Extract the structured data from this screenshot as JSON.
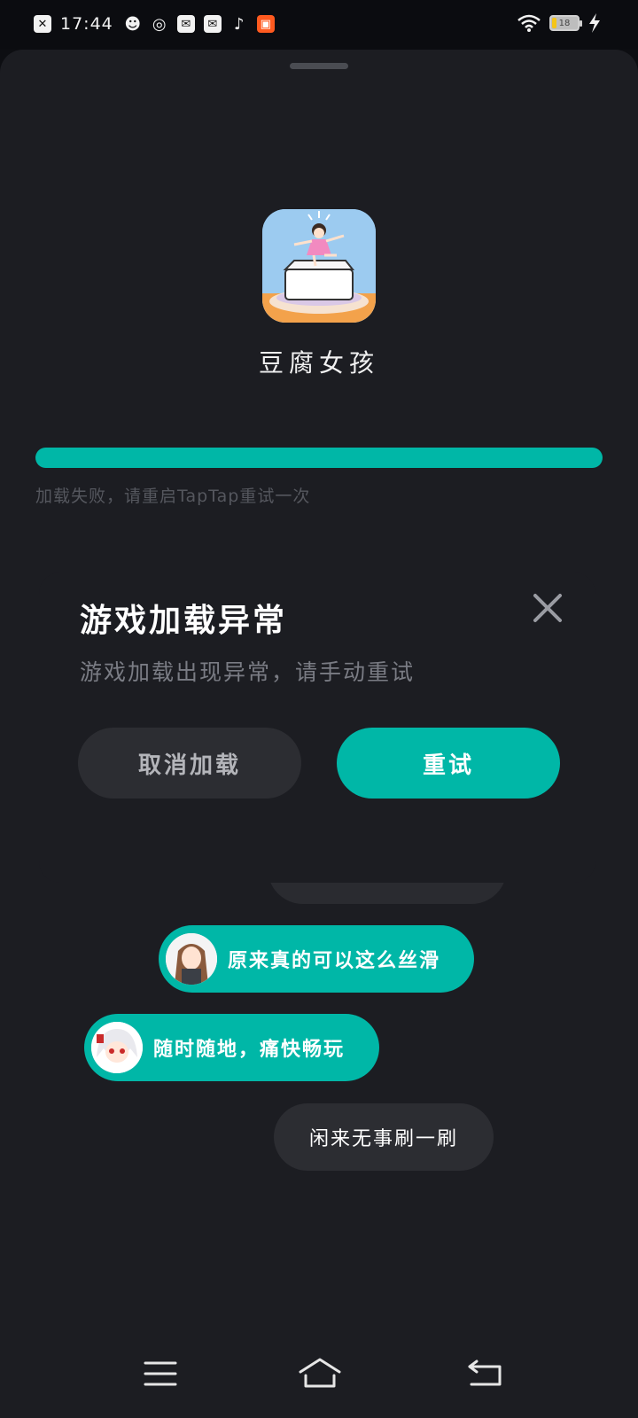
{
  "status_bar": {
    "time": "17:44",
    "battery_level": "18",
    "notification_icons": [
      "close-box-icon",
      "robot-icon",
      "planet-icon",
      "mail-icon",
      "mail-icon",
      "tiktok-icon",
      "app-orange-icon"
    ],
    "right_icons": [
      "wifi-icon",
      "battery-icon",
      "charging-icon"
    ]
  },
  "app": {
    "name": "豆腐女孩",
    "progress_percent": 100
  },
  "load_error_text": "加载失败，请重启TapTap重试一次",
  "dialog": {
    "title": "游戏加载异常",
    "message": "游戏加载出现异常，请手动重试",
    "cancel_label": "取消加载",
    "retry_label": "重试"
  },
  "chat_bubbles": [
    {
      "text": "原来真的可以这么丝滑",
      "style": "teal",
      "avatar": "anime-girl-avatar"
    },
    {
      "text": "随时随地，痛快畅玩",
      "style": "teal",
      "avatar": "anime-white-hair-avatar"
    },
    {
      "text": "闲来无事刷一刷",
      "style": "dark"
    }
  ],
  "colors": {
    "accent": "#00b7a7",
    "sheet_bg": "#1c1d22",
    "button_dark": "#2c2d32"
  }
}
